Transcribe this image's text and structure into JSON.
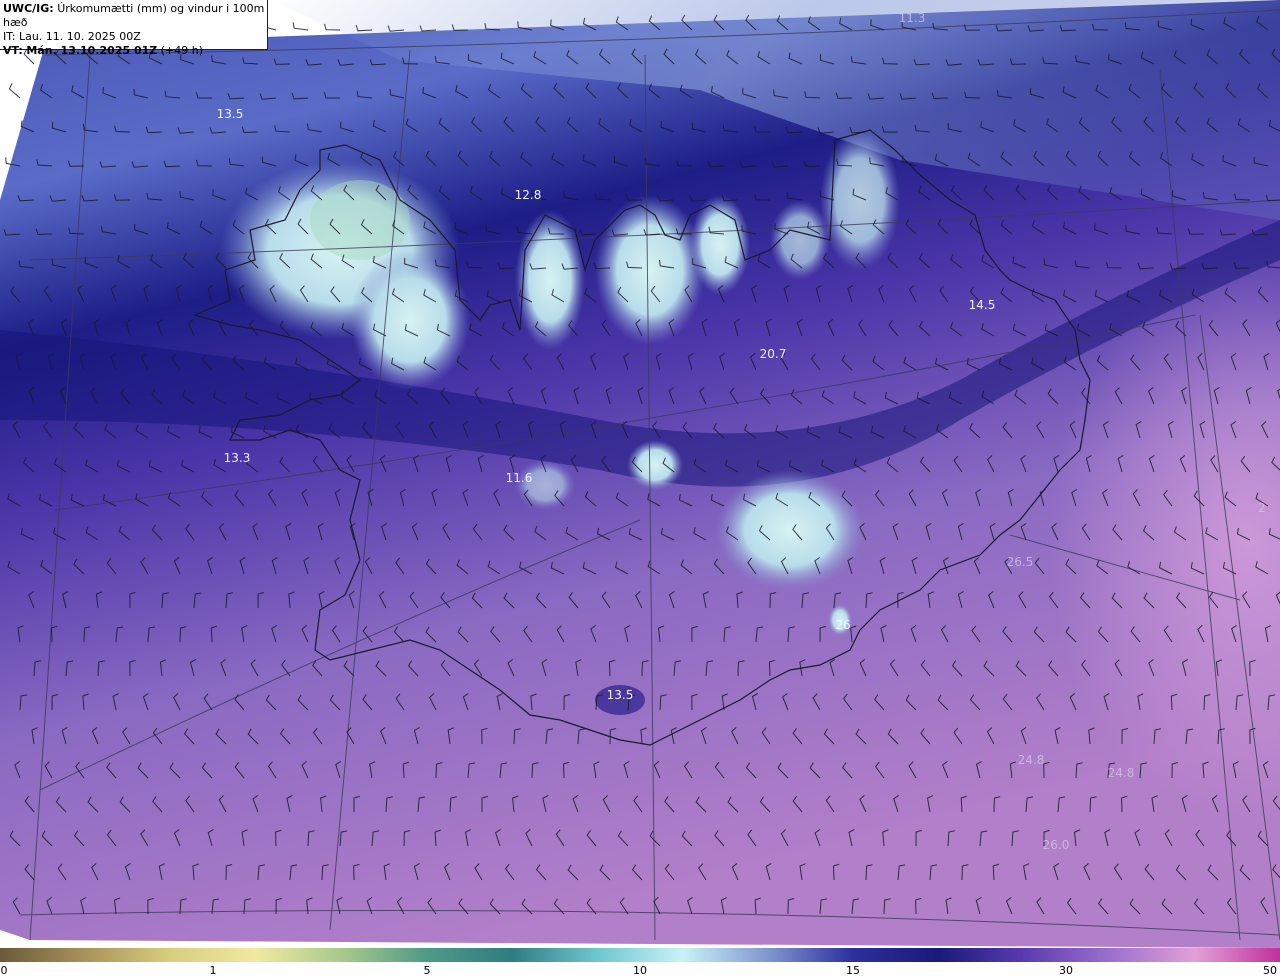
{
  "header": {
    "model": "UWC/IG:",
    "title": "Úrkomumætti (mm) og vindur i 100m hæð",
    "it_label": "IT: Lau. 11. 10. 2025 00Z",
    "vt_prefix": "VT:",
    "vt_value": "Mán. 13.10.2025 01Z",
    "vt_lead": "(+49 h)"
  },
  "map_values": [
    {
      "text": "11.3",
      "faint": true
    },
    {
      "text": "13.5",
      "faint": false
    },
    {
      "text": "12.8",
      "faint": false
    },
    {
      "text": "14.5",
      "faint": false
    },
    {
      "text": "20.7",
      "faint": false
    },
    {
      "text": "13.3",
      "faint": false
    },
    {
      "text": "11.6",
      "faint": false
    },
    {
      "text": "26.5",
      "faint": true
    },
    {
      "text": "26",
      "faint": false
    },
    {
      "text": "13.5",
      "faint": false
    },
    {
      "text": "24.8",
      "faint": true
    },
    {
      "text": "24.8",
      "faint": true
    },
    {
      "text": "26.0",
      "faint": true
    },
    {
      "text": "2",
      "faint": true
    }
  ],
  "colorbar": {
    "ticks": [
      "0",
      "1",
      "5",
      "10",
      "15",
      "30",
      "50"
    ],
    "stops": [
      "#6b5a3a",
      "#a8935a",
      "#d9cd7e",
      "#f0e9a0",
      "#a9c98c",
      "#4f9a86",
      "#2e7d83",
      "#6fc6cf",
      "#c8f2f7",
      "#7f96cf",
      "#2c2f9e",
      "#1a1a7a",
      "#5a3bb0",
      "#9a6fcc",
      "#e2a0d8",
      "#c0309a"
    ]
  }
}
